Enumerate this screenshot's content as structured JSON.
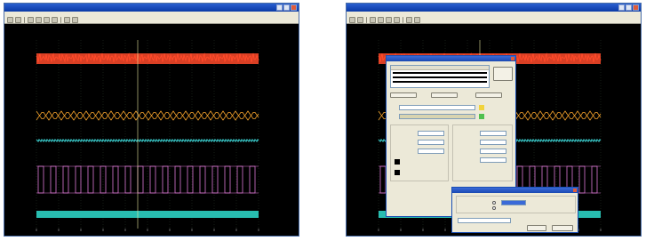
{
  "colors": {
    "plot_bg": "#000000",
    "grid": "#2a3a2a",
    "red_trace": "#ff4a2a",
    "orange_trace": "#f1a02b",
    "cyan_trace": "#39c8c8",
    "magenta_trace": "#dd7ad6",
    "teal_trace": "#28bdb0",
    "cursor": "#e8e8a0",
    "title": "#f1d33b"
  },
  "left": {
    "window_title": "",
    "menu_items": [],
    "plot_title": "",
    "subtitle": "",
    "right_labels": []
  },
  "right": {
    "window_title": "",
    "plot_title": "",
    "dialog1": {
      "title": ""
    },
    "dialog2": {
      "title": ""
    }
  },
  "icons": [
    "open-icon",
    "save-icon",
    "zoom-in-icon",
    "zoom-out-icon",
    "zoom-fit-icon",
    "cursor-icon",
    "settings-icon",
    "help-icon"
  ]
}
